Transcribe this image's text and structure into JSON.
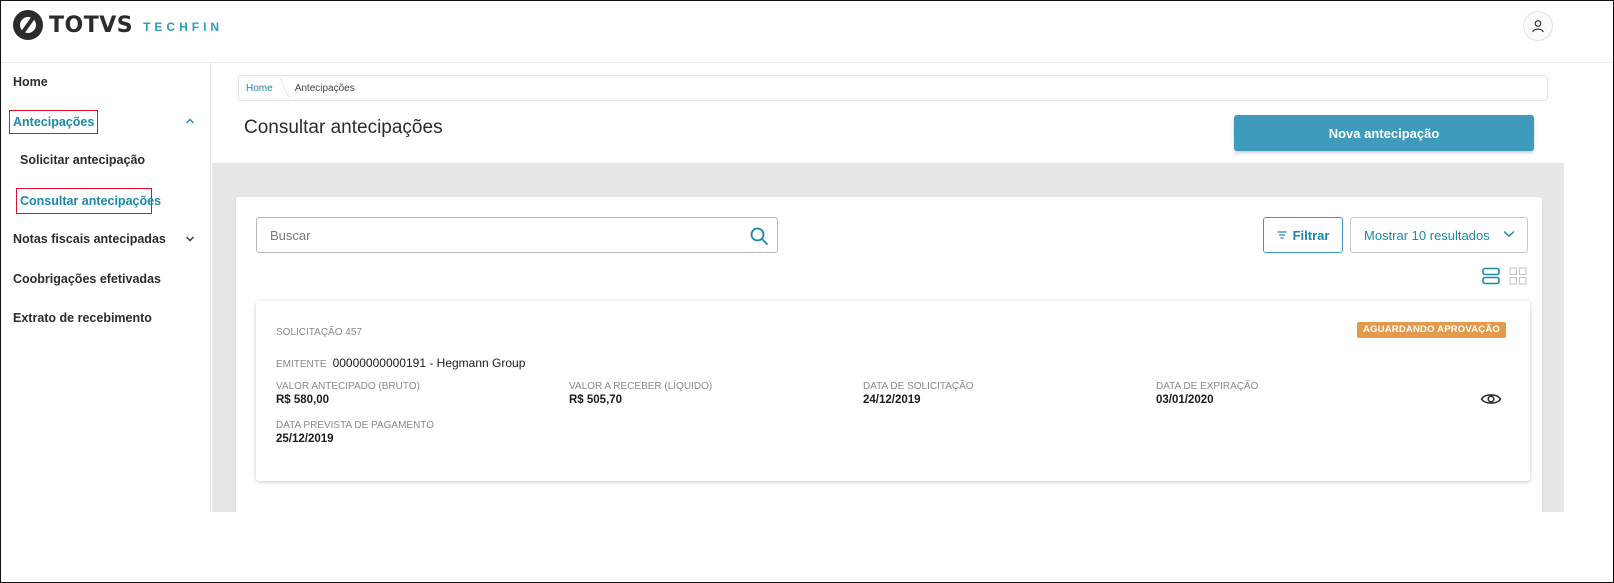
{
  "header": {
    "brand": "TOTVS",
    "brand_sub": "TECHFIN",
    "user_icon": "user-icon"
  },
  "sidebar": {
    "items": [
      {
        "label": "Home"
      },
      {
        "label": "Antecipações",
        "expanded": true
      },
      {
        "label": "Solicitar antecipação"
      },
      {
        "label": "Consultar antecipações",
        "active": true
      },
      {
        "label": "Notas fiscais antecipadas",
        "expanded": false
      },
      {
        "label": "Coobrigações efetivadas"
      },
      {
        "label": "Extrato de recebimento"
      }
    ]
  },
  "breadcrumb": {
    "home": "Home",
    "current": "Antecipações"
  },
  "page": {
    "title": "Consultar antecipações",
    "new_button": "Nova antecipação"
  },
  "toolbar": {
    "search_placeholder": "Buscar",
    "filter_label": "Filtrar",
    "results_label": "Mostrar 10 resultados"
  },
  "card": {
    "request": "SOLICITAÇÃO 457",
    "status": "AGUARDANDO APROVAÇÃO",
    "issuer_label": "EMITENTE",
    "issuer_value": "00000000000191 - Hegmann Group",
    "fields": [
      {
        "label": "VALOR ANTECIPADO (BRUTO)",
        "value": "R$ 580,00"
      },
      {
        "label": "VALOR A RECEBER (LÍQUIDO)",
        "value": "R$ 505,70"
      },
      {
        "label": "DATA DE SOLICITAÇÃO",
        "value": "24/12/2019"
      },
      {
        "label": "DATA DE EXPIRAÇÃO",
        "value": "03/01/2020"
      },
      {
        "label": "DATA PREVISTA DE PAGAMENTO",
        "value": "25/12/2019"
      }
    ]
  },
  "colors": {
    "accent": "#1b8aa8",
    "primary_button": "#3e9bbc",
    "status_badge": "#e39a4b",
    "highlight_box": "#e0102c"
  }
}
